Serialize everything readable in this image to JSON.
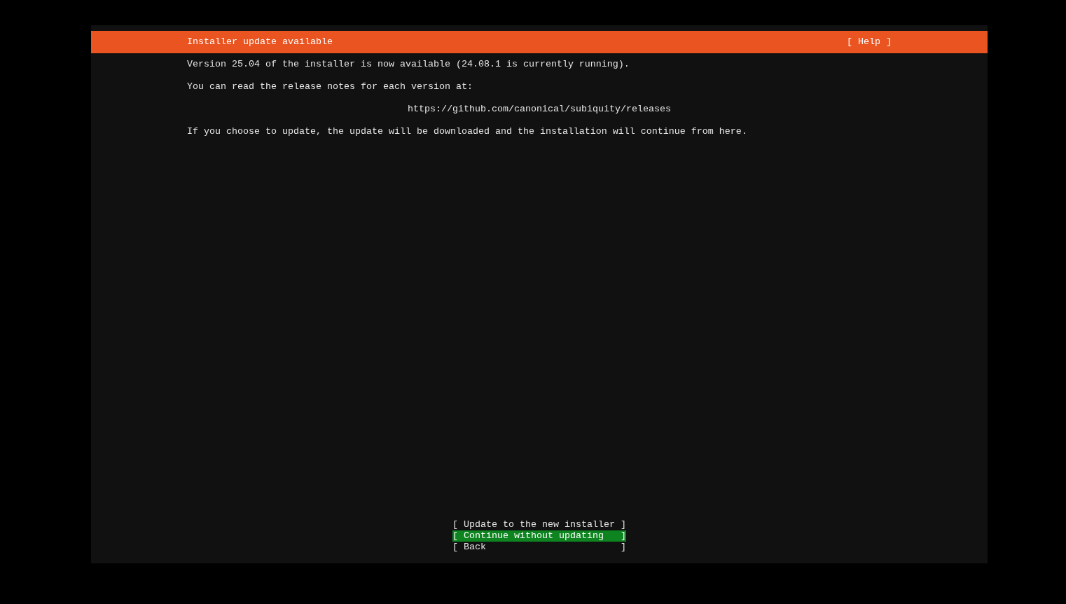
{
  "header": {
    "title": "Installer update available",
    "help": "[ Help ]"
  },
  "body": [
    {
      "kind": "text",
      "text": "Version 25.04 of the installer is now available (24.08.1 is currently running)."
    },
    {
      "kind": "text",
      "text": "You can read the release notes for each version at:"
    },
    {
      "kind": "link",
      "text": "https://github.com/canonical/subiquity/releases"
    },
    {
      "kind": "text",
      "text": "If you choose to update, the update will be downloaded and the installation will continue from here."
    }
  ],
  "buttons": [
    {
      "open": "[",
      "label": "Update to the new installer",
      "close": "]",
      "selected": false
    },
    {
      "open": "[",
      "label": "Continue without updating",
      "close": "]",
      "selected": true
    },
    {
      "open": "[",
      "label": "Back",
      "close": "]",
      "selected": false
    }
  ]
}
